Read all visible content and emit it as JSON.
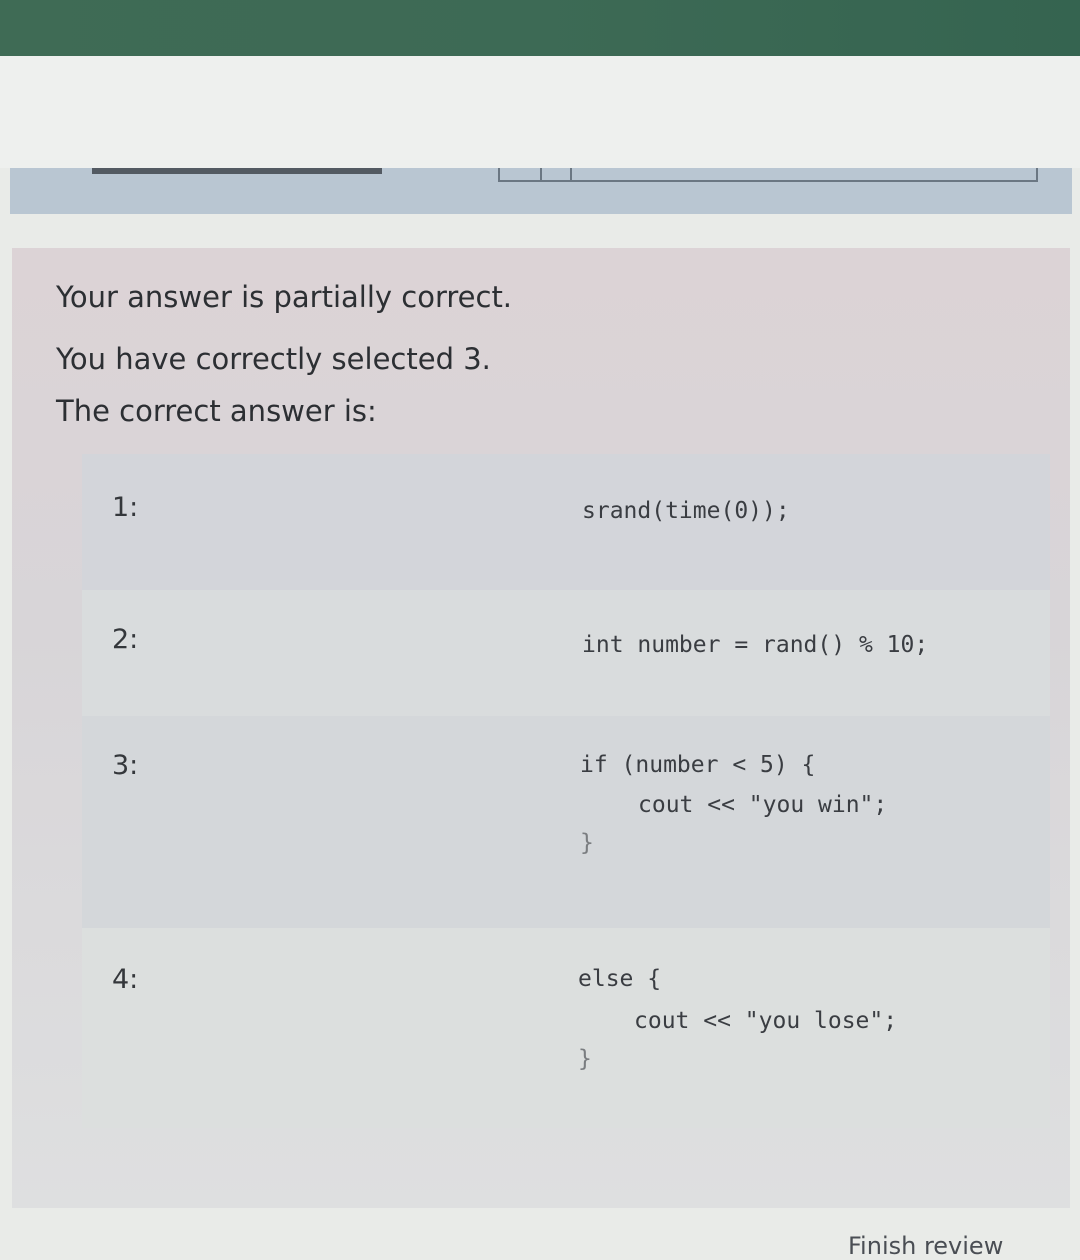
{
  "feedback": {
    "status": "Your answer is partially correct.",
    "selected": "You have correctly selected 3.",
    "correct_heading": "The correct answer is:"
  },
  "answers": [
    {
      "num": "1:",
      "lines": [
        "srand(time(0));"
      ]
    },
    {
      "num": "2:",
      "lines": [
        "int number = rand() % 10;"
      ]
    },
    {
      "num": "3:",
      "lines": [
        "if (number < 5) {",
        "cout << \"you win\";",
        "}"
      ]
    },
    {
      "num": "4:",
      "lines": [
        "else {",
        "cout << \"you lose\";",
        "}"
      ]
    }
  ],
  "footer": {
    "finish_review": "Finish review"
  }
}
